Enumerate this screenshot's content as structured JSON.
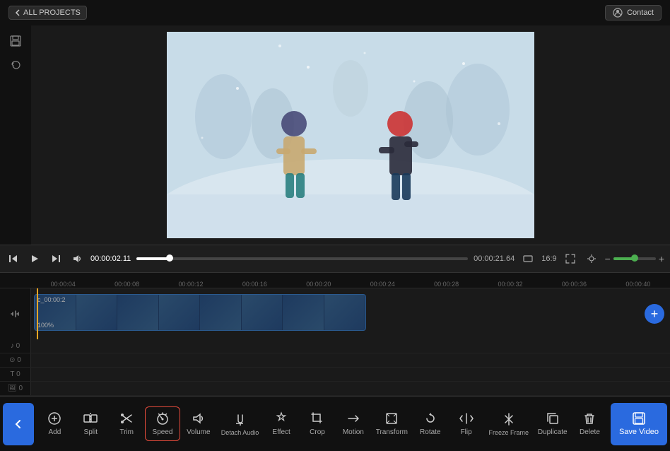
{
  "topbar": {
    "back_label": "ALL PROJECTS",
    "contact_label": "Contact"
  },
  "transport": {
    "current_time": "00:00:02.11",
    "total_time": "00:00:21.64",
    "aspect_ratio": "16:9",
    "progress_percent": 10
  },
  "ruler": {
    "marks": [
      "00:00:04",
      "00:00:08",
      "00:00:12",
      "00:00:16",
      "00:00:20",
      "00:00:24",
      "00:00:28",
      "00:00:32",
      "00:00:36",
      "00:00:40"
    ]
  },
  "clip": {
    "label": "c_00:00:2",
    "percentage": "100%"
  },
  "tools": [
    {
      "id": "add",
      "label": "Add",
      "icon": "+",
      "active": false
    },
    {
      "id": "split",
      "label": "Split",
      "icon": "⫛",
      "active": false
    },
    {
      "id": "trim",
      "label": "Trim",
      "icon": "✂",
      "active": false
    },
    {
      "id": "speed",
      "label": "Speed",
      "icon": "⏱",
      "active": true
    },
    {
      "id": "volume",
      "label": "Volume",
      "icon": "🔊",
      "active": false
    },
    {
      "id": "detach-audio",
      "label": "Detach Audio",
      "icon": "♪",
      "active": false
    },
    {
      "id": "effect",
      "label": "Effect",
      "icon": "✨",
      "active": false
    },
    {
      "id": "crop",
      "label": "Crop",
      "icon": "⬜",
      "active": false
    },
    {
      "id": "motion",
      "label": "Motion",
      "icon": "➡",
      "active": false
    },
    {
      "id": "transform",
      "label": "Transform",
      "icon": "⤢",
      "active": false
    },
    {
      "id": "rotate",
      "label": "Rotate",
      "icon": "↺",
      "active": false
    },
    {
      "id": "flip",
      "label": "Flip",
      "icon": "⇔",
      "active": false
    },
    {
      "id": "freeze-frame",
      "label": "Freeze Frame",
      "icon": "❄",
      "active": false
    },
    {
      "id": "duplicate",
      "label": "Duplicate",
      "icon": "⧉",
      "active": false
    },
    {
      "id": "delete",
      "label": "Delete",
      "icon": "🗑",
      "active": false
    }
  ],
  "save_video": {
    "label": "Save Video",
    "icon": "💾"
  },
  "extra_tracks": [
    {
      "label": "♪ 0"
    },
    {
      "label": "⊙ 0"
    },
    {
      "label": "T 0"
    },
    {
      "label": "🖼 0"
    }
  ]
}
